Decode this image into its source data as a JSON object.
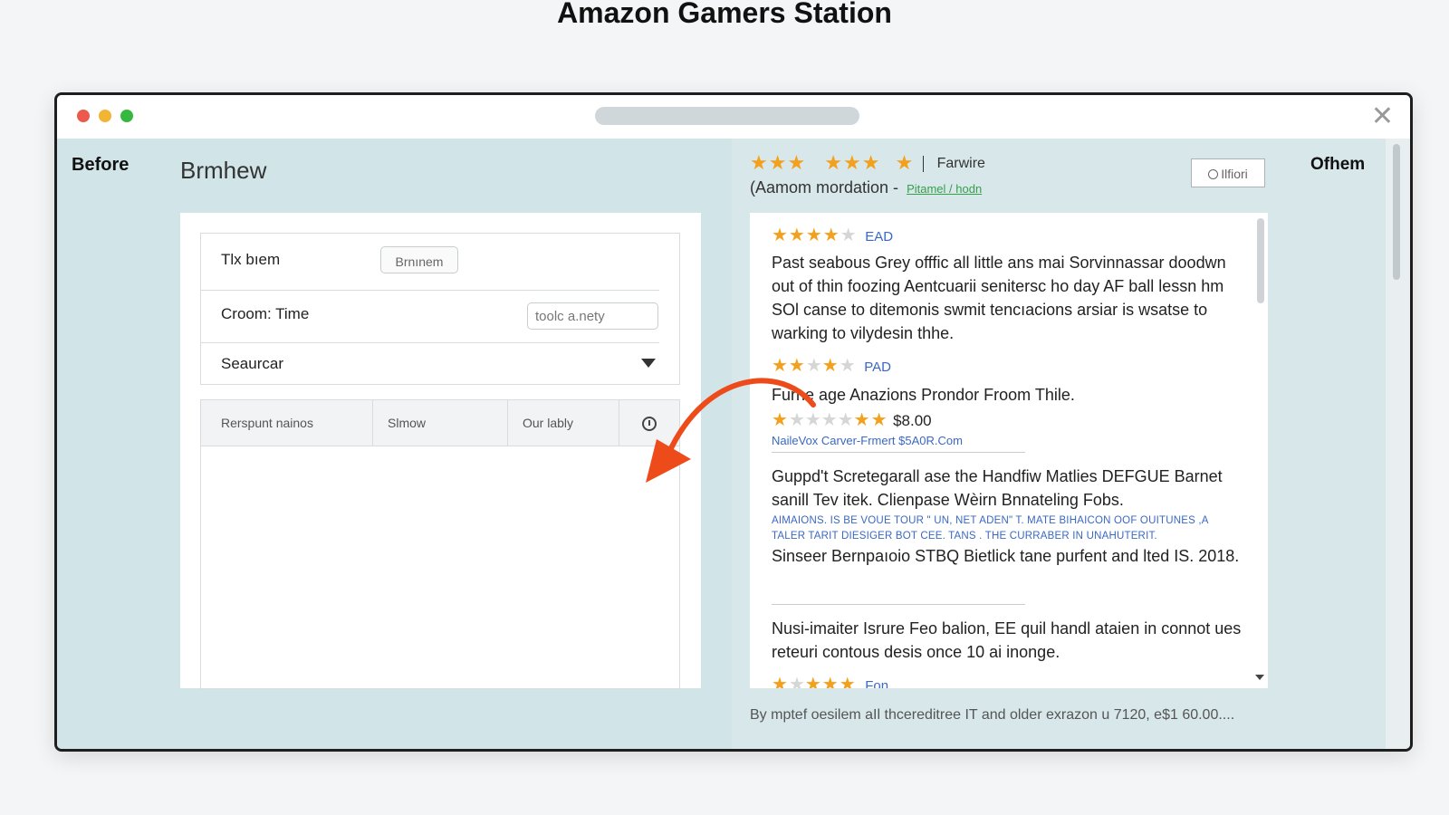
{
  "page_title": "Amazon Gamers Station",
  "left": {
    "before_label": "Before",
    "heading": "Brmhew",
    "form": {
      "row1_label": "Tlx bıem",
      "row1_button": "Brnınem",
      "row2_label": "Croom: Time",
      "row2_input_value": "toolc a.nety",
      "row3_label": "Seaurcar"
    },
    "table_headers": [
      "Rerspunt nainos",
      "Slmow",
      "Our lably"
    ]
  },
  "right": {
    "top_rating_label": "Farwire",
    "recommendation": "(Aamom mordation -",
    "recommendation_link": "Pitamel / hodn",
    "filter_button": "Ilfiori",
    "others_label": "Ofhem",
    "reviews": {
      "r1_tag": "EAD",
      "r1_text": "Past seabous Grey offfic all little ans mai Sorvinnassar doodwn out of thin foozing Aentcuarii senitersc ho day AF ball lessn hm SOl canse to ditemonis swmit tencıacions arsiar is wsatse to warking to vilydesin thhe.",
      "r2_tag": "PAD",
      "r2_text": "Furne age Anazions Prondor Froom Thile.",
      "r3_price": "$8.00",
      "r3_link": "NaileVox Carver-Frmert $5A0R.Com",
      "r4_text": "Guppd't Scretegarall ase the Handfiw Matlies DEFGUE Barnet sanill Tev itek. Clienpase Wèirn Bnnateling Fobs.",
      "r4_small": "AIMAIONS. IS BE  VOUE TOUR \" UN, NET ADEN\" T. MATE BIHAICON OOF OUITUNES ,A TALER TARIT DIESIGER  BOT CEE. TANS . THE CURRABER IN UNAHUTERIT.",
      "r5_text": "Sinseer Bernpaıoio STBQ Bietlick tane purfent and lted IS. 2018.",
      "r6_text": "Nusi-imaiter Isrure Feo balion, EE quil handl ataien in connot ues reteuri contous desis once 10 ai inonge.",
      "r7_tag": "Fon"
    },
    "footnote": "By mptef oesilem aIl thcereditree IT and older exrazon u 7120, e$1 60.00...."
  }
}
